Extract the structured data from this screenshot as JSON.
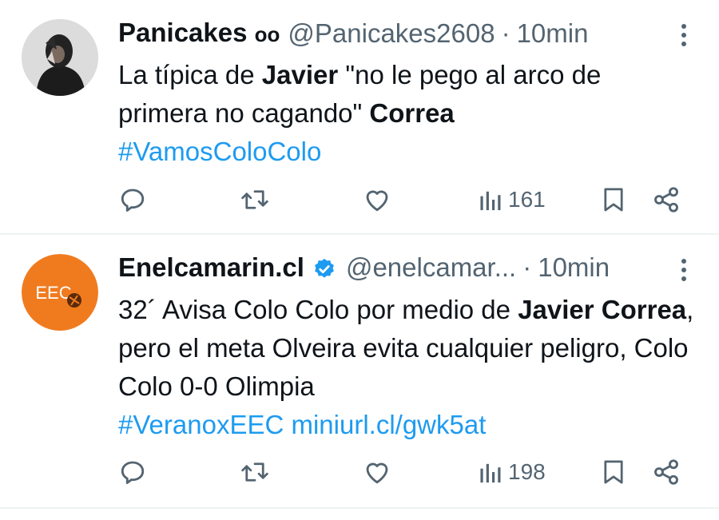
{
  "tweets": [
    {
      "name": "Panicakes",
      "name_suffix": "ᴏᴏ",
      "handle": "@Panicakes2608",
      "separator": "·",
      "time": "10min",
      "text": {
        "t1": "La típica de ",
        "b1": "Javier",
        "t2": " \"no le pego al arco de primera no cagando\" ",
        "b2": "Correa"
      },
      "hashtag": "#VamosColoColo",
      "views": "161",
      "verified": false
    },
    {
      "name": "Enelcamarin.cl",
      "handle": "@enelcamar...",
      "separator": "·",
      "time": "10min",
      "avatar_text": "EEC",
      "text": {
        "t1": "32´ Avisa Colo Colo por medio de ",
        "b1": "Javier Correa",
        "t2": ", pero el meta Olveira evita cualquier peligro, Colo Colo 0-0 Olimpia"
      },
      "hashtag": "#VeranoxEEC",
      "link": "miniurl.cl/gwk5at",
      "views": "198",
      "verified": true
    }
  ],
  "icons": [
    "reply-icon",
    "retweet-icon",
    "like-icon",
    "views-icon",
    "bookmark-icon",
    "share-icon",
    "more-icon",
    "verified-badge-icon"
  ],
  "colors": {
    "text": "#0f1419",
    "muted": "#536471",
    "link": "#1d9bf0",
    "verified": "#1d9bf0",
    "avatar_orange": "#f07b1f",
    "divider": "#eff3f4"
  }
}
